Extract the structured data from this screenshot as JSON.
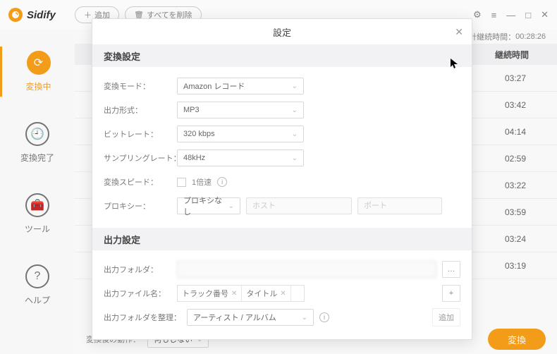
{
  "app": {
    "name": "Sidify"
  },
  "toolbar": {
    "add": "追加",
    "clear_all": "すべてを削除"
  },
  "window": {
    "gear": "⚙",
    "menu": "≡",
    "min": "—",
    "max": "□",
    "close": "✕"
  },
  "sidebar": {
    "items": [
      {
        "label": "変換中"
      },
      {
        "label": "変換完了"
      },
      {
        "label": "ツール"
      },
      {
        "label": "ヘルプ"
      }
    ]
  },
  "header_info": {
    "total_label": "合計継続時間：",
    "total_value": "00:28:26"
  },
  "list": {
    "col_duration": "継続時間",
    "rows": [
      "03:27",
      "03:42",
      "04:14",
      "02:59",
      "03:22",
      "03:59",
      "03:24",
      "03:19"
    ]
  },
  "bottom": {
    "after_label": "変換後の動作：",
    "after_value": "何もしない",
    "convert": "変換"
  },
  "modal": {
    "title": "設定",
    "sec1": "変換設定",
    "sec2": "出力設定",
    "mode_lbl": "変換モード：",
    "mode_val": "Amazon レコード",
    "format_lbl": "出力形式：",
    "format_val": "MP3",
    "bitrate_lbl": "ビットレート：",
    "bitrate_val": "320 kbps",
    "sample_lbl": "サンプリングレート：",
    "sample_val": "48kHz",
    "speed_lbl": "変換スピード：",
    "speed_val": "1倍速",
    "proxy_lbl": "プロキシー：",
    "proxy_sel": "プロキシなし",
    "proxy_host": "ホスト",
    "proxy_port": "ポート",
    "folder_lbl": "出力フォルダ：",
    "browse": "…",
    "filename_lbl": "出力ファイル名：",
    "tag1": "トラック番号",
    "tag2": "タイトル",
    "plus": "+",
    "add": "追加",
    "org_lbl": "出力フォルダを整理：",
    "org_val": "アーティスト / アルバム"
  }
}
